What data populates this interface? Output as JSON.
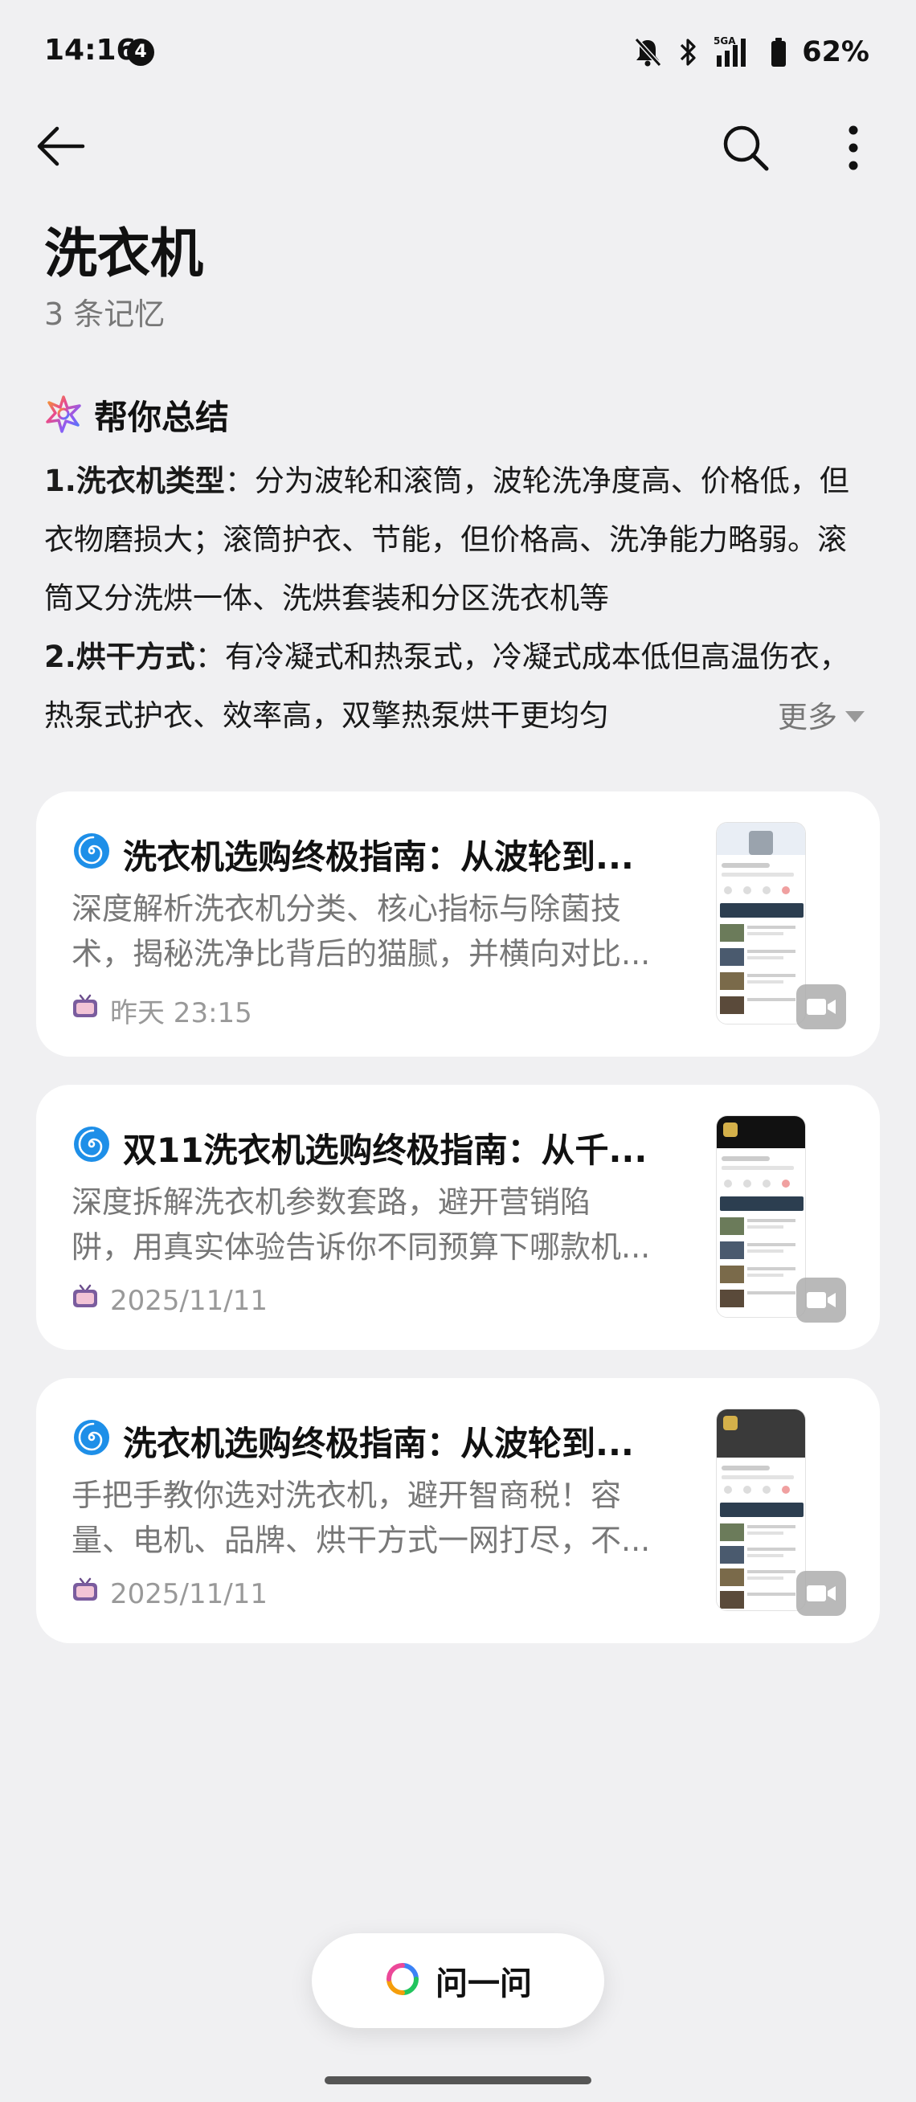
{
  "status_bar": {
    "time": "14:16",
    "notification_count": "4",
    "network": "5GA",
    "battery_percent": "62%"
  },
  "header": {
    "title": "洗衣机",
    "memory_count": "3 条记忆"
  },
  "summary": {
    "heading": "帮你总结",
    "items": [
      {
        "label": "1.洗衣机类型",
        "sep": "：",
        "text": "分为波轮和滚筒，波轮洗净度高、价格低，但衣物磨损大；滚筒护衣、节能，但价格高、洗净能力略弱。滚筒又分洗烘一体、洗烘套装和分区洗衣机等"
      },
      {
        "label": "2.烘干方式",
        "sep": "：",
        "text": "有冷凝式和热泵式，冷凝式成本低但高温伤衣，热泵式护衣、效率高，双擎热泵烘干更均匀"
      }
    ],
    "more_label": "更多"
  },
  "cards": [
    {
      "title": "洗衣机选购终极指南：从波轮到...",
      "desc_line1": "深度解析洗衣机分类、核心指标与除菌技",
      "desc_line2": "术，揭秘洗净比背后的猫腻，并横向对比...",
      "date": "昨天 23:15"
    },
    {
      "title": "双11洗衣机选购终极指南：从千...",
      "desc_line1": "深度拆解洗衣机参数套路，避开营销陷",
      "desc_line2": "阱，用真实体验告诉你不同预算下哪款机...",
      "date": "2025/11/11"
    },
    {
      "title": "洗衣机选购终极指南：从波轮到...",
      "desc_line1": "手把手教你选对洗衣机，避开智商税！容",
      "desc_line2": "量、电机、品牌、烘干方式一网打尽，不...",
      "date": "2025/11/11"
    }
  ],
  "ask_button": {
    "label": "问一问"
  },
  "icons": {
    "back": "back-arrow-icon",
    "search": "search-icon",
    "more": "more-vertical-icon",
    "summary": "ai-sparkle-icon",
    "card": "spiral-icon",
    "source": "tv-icon",
    "video": "video-camera-icon"
  },
  "colors": {
    "background": "#F0F0F2",
    "card": "#FFFFFF",
    "primary_text": "#111111",
    "secondary_text": "#777777",
    "spiral_blue": "#1E8FE8"
  }
}
